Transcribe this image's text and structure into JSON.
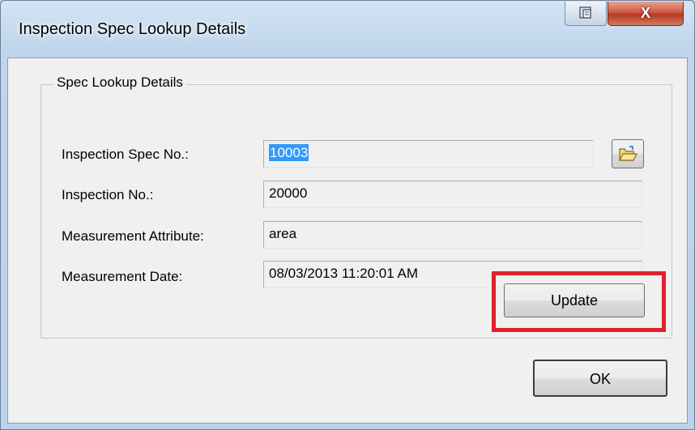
{
  "window": {
    "title": "Inspection Spec Lookup Details",
    "close_label": "X"
  },
  "group": {
    "title": "Spec Lookup Details"
  },
  "fields": {
    "spec_no": {
      "label": "Inspection Spec No.:",
      "value": "10003",
      "selected": true
    },
    "inspection_no": {
      "label": "Inspection No.:",
      "value": "20000"
    },
    "measurement_attribute": {
      "label": "Measurement Attribute:",
      "value": "area"
    },
    "measurement_date": {
      "label": "Measurement Date:",
      "value": "08/03/2013 11:20:01 AM"
    }
  },
  "buttons": {
    "update": "Update",
    "ok": "OK"
  },
  "colors": {
    "selection": "#3399ff",
    "highlight_box": "#e0202c"
  },
  "icons": {
    "help": "context-help-icon",
    "close": "close-icon",
    "browse": "open-folder-icon"
  }
}
